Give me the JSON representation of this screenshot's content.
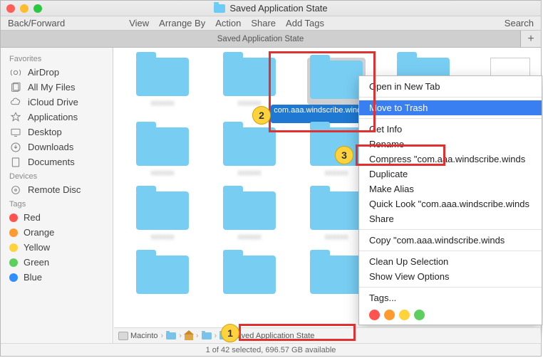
{
  "window": {
    "title": "Saved Application State"
  },
  "toolbar": {
    "back_forward": "Back/Forward",
    "menus": [
      "View",
      "Arrange By",
      "Action",
      "Share",
      "Add Tags"
    ],
    "search": "Search"
  },
  "tab": {
    "label": "Saved Application State"
  },
  "sidebar": {
    "sections": [
      {
        "header": "Favorites",
        "items": [
          {
            "label": "AirDrop",
            "icon": "airdrop-icon"
          },
          {
            "label": "All My Files",
            "icon": "all-my-files-icon"
          },
          {
            "label": "iCloud Drive",
            "icon": "icloud-icon"
          },
          {
            "label": "Applications",
            "icon": "applications-icon"
          },
          {
            "label": "Desktop",
            "icon": "desktop-icon"
          },
          {
            "label": "Downloads",
            "icon": "downloads-icon"
          },
          {
            "label": "Documents",
            "icon": "documents-icon"
          }
        ]
      },
      {
        "header": "Devices",
        "items": [
          {
            "label": "Remote Disc",
            "icon": "remote-disc-icon"
          }
        ]
      },
      {
        "header": "Tags",
        "items": [
          {
            "label": "Red",
            "color": "#ff534f"
          },
          {
            "label": "Orange",
            "color": "#ff9a2f"
          },
          {
            "label": "Yellow",
            "color": "#ffd33b"
          },
          {
            "label": "Green",
            "color": "#5dcf5e"
          },
          {
            "label": "Blue",
            "color": "#2f8fff"
          }
        ]
      }
    ]
  },
  "selected_item": {
    "label": "com.aaa.windscribe.wind...vedState"
  },
  "context_menu": {
    "sections": [
      [
        "Open in New Tab"
      ],
      [
        "Move to Trash"
      ],
      [
        "Get Info",
        "Rename",
        "Compress \"com.aaa.windscribe.winds",
        "Duplicate",
        "Make Alias",
        "Quick Look \"com.aaa.windscribe.winds",
        "Share"
      ],
      [
        "Copy \"com.aaa.windscribe.winds"
      ],
      [
        "Clean Up Selection",
        "Show View Options"
      ],
      [
        "Tags..."
      ]
    ],
    "highlighted": "Move to Trash",
    "tag_colors": [
      "#ff534f",
      "#ff9a2f",
      "#ffd33b",
      "#5dcf5e"
    ]
  },
  "pathbar": {
    "segments": [
      {
        "label": "Macinto",
        "icon": "hd"
      },
      {
        "label": "",
        "icon": "folder"
      },
      {
        "label": "",
        "icon": "home"
      },
      {
        "label": "",
        "icon": "folder"
      },
      {
        "label": "Saved Application State",
        "icon": "folder"
      }
    ]
  },
  "statusbar": {
    "text": "1 of 42 selected, 696.57 GB available"
  },
  "callouts": {
    "c1": "1",
    "c2": "2",
    "c3": "3"
  }
}
